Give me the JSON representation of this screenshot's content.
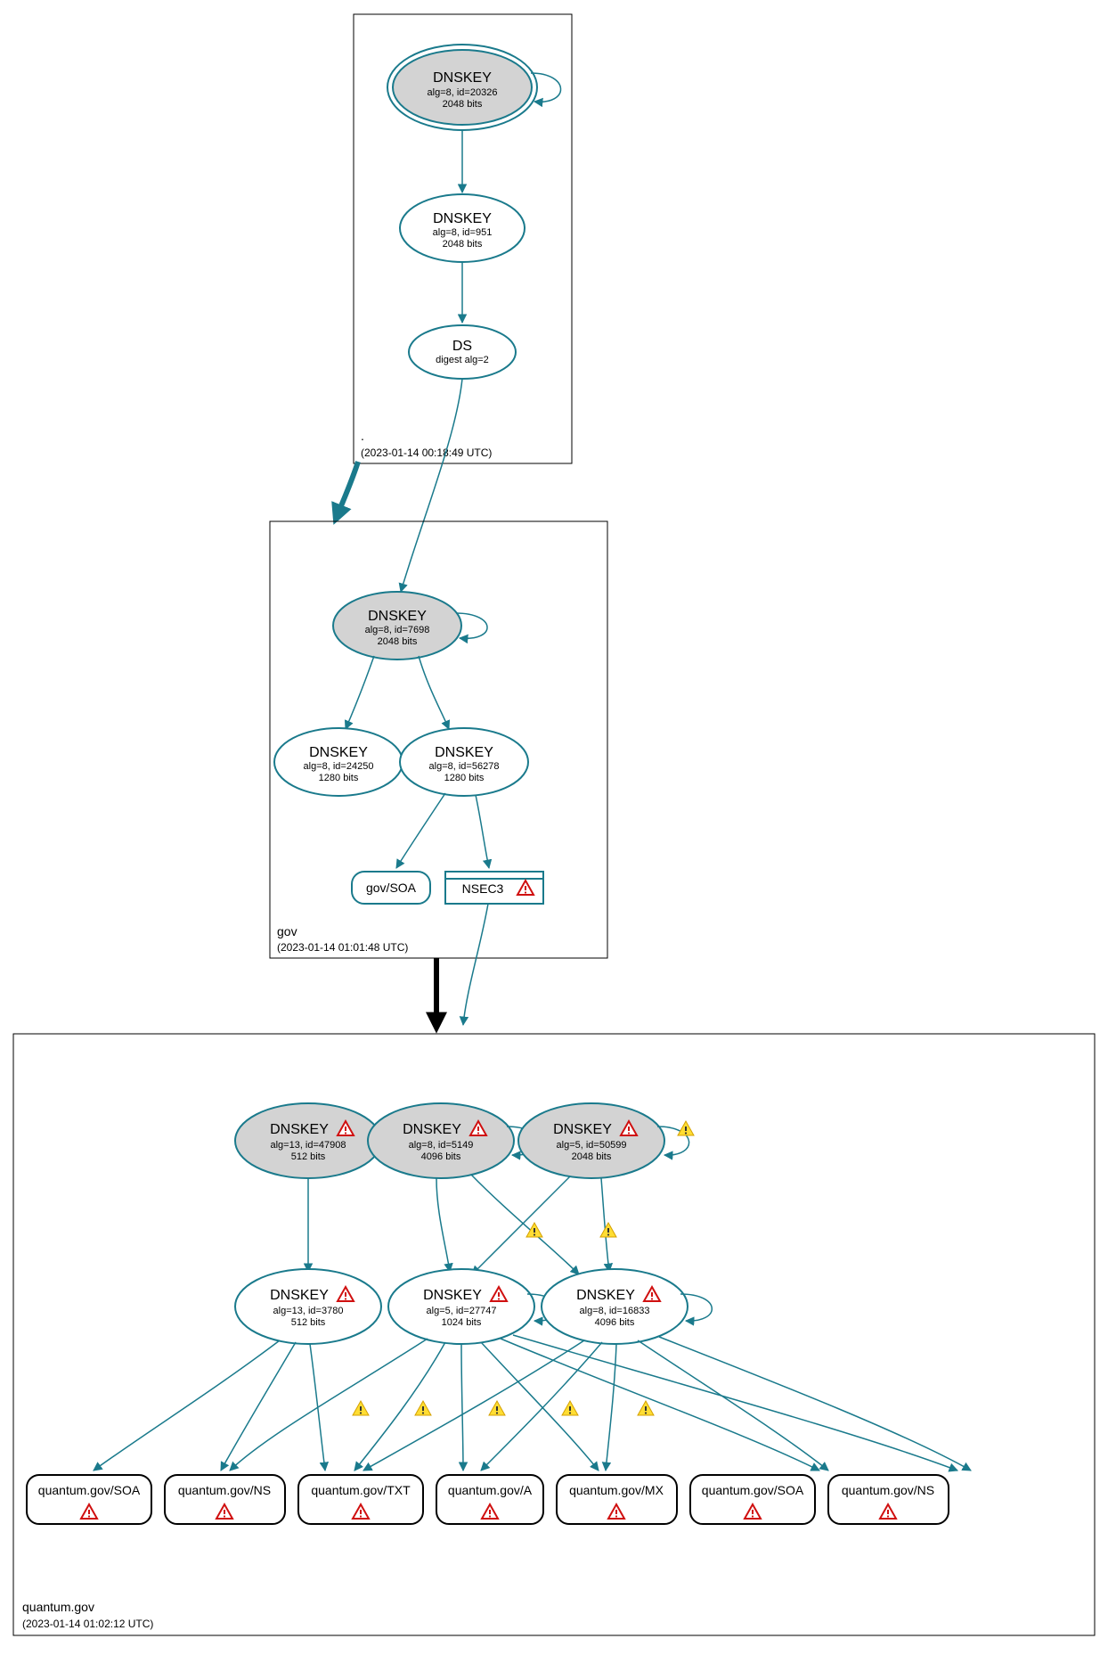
{
  "zones": {
    "root": {
      "label": ".",
      "timestamp": "(2023-01-14 00:18:49 UTC)",
      "nodes": {
        "dnskey1": {
          "title": "DNSKEY",
          "line1": "alg=8, id=20326",
          "line2": "2048 bits"
        },
        "dnskey2": {
          "title": "DNSKEY",
          "line1": "alg=8, id=951",
          "line2": "2048 bits"
        },
        "ds": {
          "title": "DS",
          "line1": "digest alg=2"
        }
      }
    },
    "gov": {
      "label": "gov",
      "timestamp": "(2023-01-14 01:01:48 UTC)",
      "nodes": {
        "dnskey1": {
          "title": "DNSKEY",
          "line1": "alg=8, id=7698",
          "line2": "2048 bits"
        },
        "dnskey2": {
          "title": "DNSKEY",
          "line1": "alg=8, id=24250",
          "line2": "1280 bits"
        },
        "dnskey3": {
          "title": "DNSKEY",
          "line1": "alg=8, id=56278",
          "line2": "1280 bits"
        },
        "soa": {
          "title": "gov/SOA"
        },
        "nsec3": {
          "title": "NSEC3"
        }
      }
    },
    "quantum": {
      "label": "quantum.gov",
      "timestamp": "(2023-01-14 01:02:12 UTC)",
      "ksk": {
        "k1": {
          "title": "DNSKEY",
          "line1": "alg=13, id=47908",
          "line2": "512 bits"
        },
        "k2": {
          "title": "DNSKEY",
          "line1": "alg=8, id=5149",
          "line2": "4096 bits"
        },
        "k3": {
          "title": "DNSKEY",
          "line1": "alg=5, id=50599",
          "line2": "2048 bits"
        }
      },
      "zsk": {
        "z1": {
          "title": "DNSKEY",
          "line1": "alg=13, id=3780",
          "line2": "512 bits"
        },
        "z2": {
          "title": "DNSKEY",
          "line1": "alg=5, id=27747",
          "line2": "1024 bits"
        },
        "z3": {
          "title": "DNSKEY",
          "line1": "alg=8, id=16833",
          "line2": "4096 bits"
        }
      },
      "records": {
        "r1": "quantum.gov/SOA",
        "r2": "quantum.gov/NS",
        "r3": "quantum.gov/TXT",
        "r4": "quantum.gov/A",
        "r5": "quantum.gov/MX",
        "r6": "quantum.gov/SOA",
        "r7": "quantum.gov/NS"
      }
    }
  }
}
